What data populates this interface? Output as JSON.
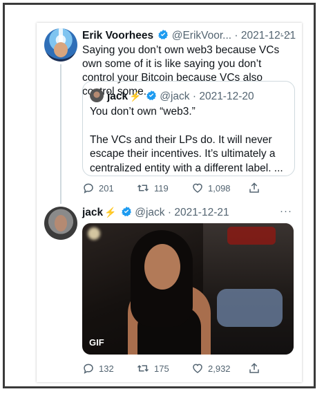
{
  "tweet1": {
    "name": "Erik Voorhees",
    "handle": "@ErikVoor...",
    "date": "· 2021-12-21",
    "more": "···",
    "text": "Saying you don’t own web3 because VCs own some of it is like saying you don’t control your Bitcoin because VCs also control some.",
    "quote": {
      "name": "jack",
      "handle": "@jack",
      "date": "· 2021-12-20",
      "line1": "You don’t own “web3.”",
      "line2": "The VCs and their LPs do. It will never escape their incentives. It’s ultimately a centralized entity with a different label. ..."
    },
    "replies": "201",
    "retweets": "119",
    "likes": "1,098"
  },
  "tweet2": {
    "name": "jack",
    "bolt": "⚡",
    "handle": "@jack",
    "date": "· 2021-12-21",
    "more": "···",
    "media_badge": "GIF",
    "replies": "132",
    "retweets": "175",
    "likes": "2,932"
  },
  "icons": {
    "verified": "verified-badge-icon",
    "reply": "reply-icon",
    "retweet": "retweet-icon",
    "like": "heart-icon",
    "share": "share-icon"
  },
  "colors": {
    "verified": "#1d9bf0",
    "text": "#0f1419",
    "muted": "#536471",
    "border": "#cfd9de",
    "bolt": "#ffad1f"
  }
}
